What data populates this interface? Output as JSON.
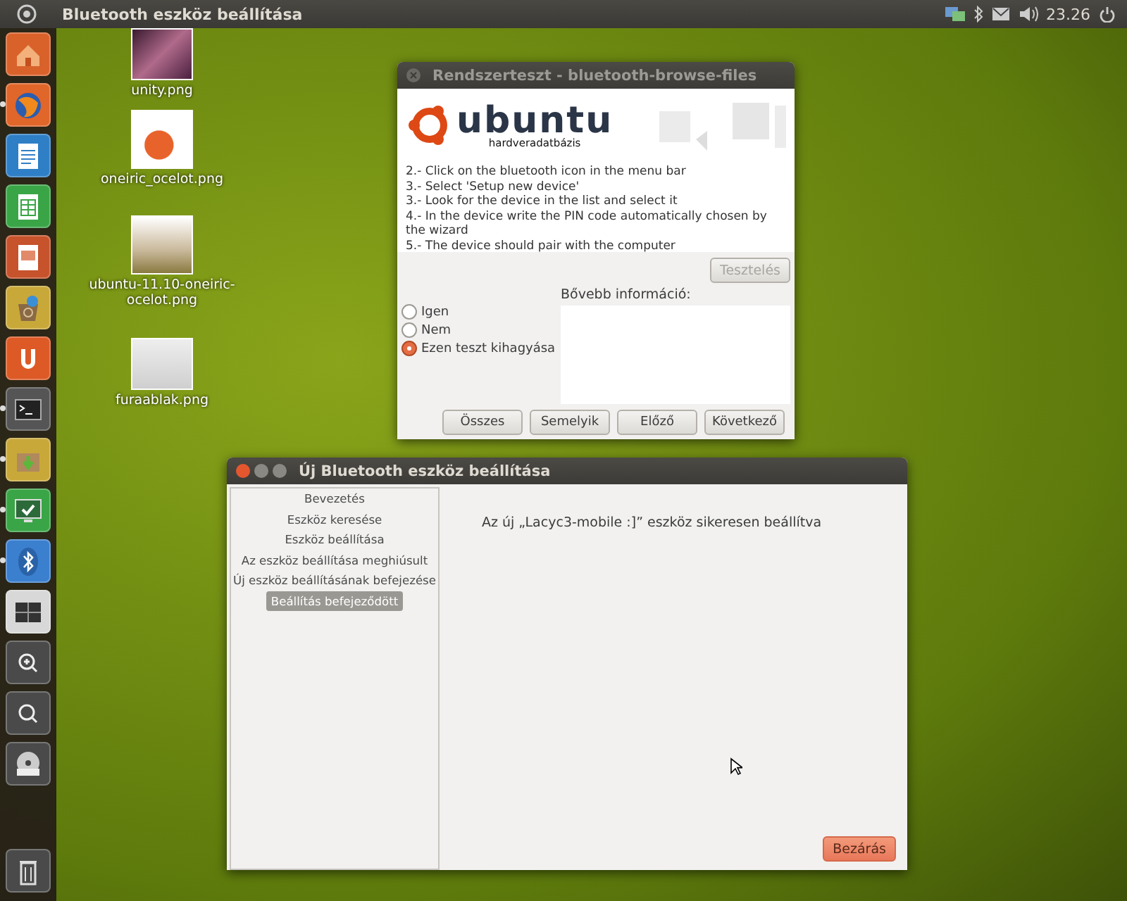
{
  "top_panel": {
    "title": "Bluetooth eszköz beállítása",
    "clock": "23.26"
  },
  "launcher": [
    {
      "kind": "home",
      "color": "#d9622b",
      "running": false
    },
    {
      "kind": "browser",
      "color": "#e0662a",
      "running": true
    },
    {
      "kind": "writer",
      "color": "#2f7fc6",
      "running": false
    },
    {
      "kind": "calc",
      "color": "#3aa547",
      "running": false
    },
    {
      "kind": "impress",
      "color": "#c6532c",
      "running": false
    },
    {
      "kind": "software",
      "color": "#c9a83a",
      "running": false
    },
    {
      "kind": "ubuntuone",
      "color": "#dd5a26",
      "running": false
    },
    {
      "kind": "terminal",
      "color": "#555555",
      "running": true
    },
    {
      "kind": "archive",
      "color": "#c9a83a",
      "running": true
    },
    {
      "kind": "monitor",
      "color": "#3aa547",
      "running": true
    },
    {
      "kind": "bluetooth",
      "color": "#3b7fcf",
      "running": true
    },
    {
      "kind": "workspaces",
      "color": "#d8d8d8",
      "running": false
    },
    {
      "kind": "zoom",
      "color": "#4a4a4a",
      "running": false
    },
    {
      "kind": "search",
      "color": "#4a4a4a",
      "running": false
    },
    {
      "kind": "dvd",
      "color": "#4a4a4a",
      "running": false
    }
  ],
  "trash": {
    "kind": "trash"
  },
  "desktop_icons": [
    {
      "kind": "wallpaper",
      "label": "unity.png"
    },
    {
      "kind": "logo",
      "label": "oneiric_ocelot.png"
    },
    {
      "kind": "poster",
      "label": "ubuntu-11.10-oneiric-ocelot.png"
    },
    {
      "kind": "screenshot",
      "label": "furaablak.png"
    }
  ],
  "test_window": {
    "title": "Rendszerteszt - bluetooth-browse-files",
    "logo_word": "ubuntu",
    "logo_caption": "hardveradatbázis",
    "instructions": [
      "2.- Click on the bluetooth icon in the menu bar",
      "3.- Select 'Setup new device'",
      "3.- Look for the device in the list and select it",
      "4.- In the device write the PIN code automatically chosen by the wizard",
      "5.- The device should pair with the computer"
    ],
    "test_button": {
      "label": "Tesztelés",
      "disabled": true
    },
    "options": [
      {
        "label": "Igen",
        "selected": false
      },
      {
        "label": "Nem",
        "selected": false
      },
      {
        "label": "Ezen teszt kihagyása",
        "selected": true
      }
    ],
    "info_label": "Bővebb információ:",
    "buttons": [
      "Összes",
      "Semelyik",
      "Előző",
      "Következő"
    ]
  },
  "bt_window": {
    "title": "Új Bluetooth eszköz beállítása",
    "steps": [
      {
        "label": "Bevezetés",
        "selected": false
      },
      {
        "label": "Eszköz keresése",
        "selected": false
      },
      {
        "label": "Eszköz beállítása",
        "selected": false
      },
      {
        "label": "Az eszköz beállítása meghiúsult",
        "selected": false
      },
      {
        "label": "Új eszköz beállításának befejezése",
        "selected": false
      },
      {
        "label": "Beállítás befejeződött",
        "selected": true
      }
    ],
    "message": "Az új „Lacyc3-mobile :]” eszköz sikeresen beállítva",
    "close_button": "Bezárás"
  }
}
